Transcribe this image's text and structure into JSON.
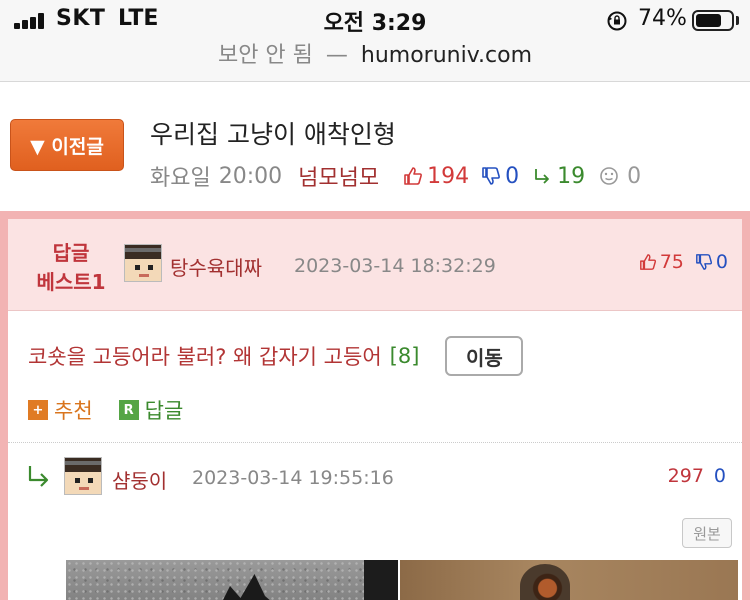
{
  "status_bar": {
    "carrier": "SKT",
    "network": "LTE",
    "time": "오전 3:29",
    "battery_percent": "74%",
    "battery_level": 0.74
  },
  "url_bar": {
    "insecure_label": "보안 안 됨",
    "separator": "—",
    "domain": "humoruniv.com"
  },
  "post": {
    "prev_button_label": "▼ 이전글",
    "title": "우리집 고냥이 애착인형",
    "day": "화요일",
    "time": "20:00",
    "author": "넘모넘모",
    "upvotes": "194",
    "downvotes": "0",
    "replies": "19",
    "views": "0"
  },
  "best_comment": {
    "badge_line1": "답글",
    "badge_line2": "베스트1",
    "author": "탕수육대짜",
    "date": "2023-03-14 18:32:29",
    "upvotes": "75",
    "downvotes": "0",
    "text": "코숏을 고등어라 불러? 왜 갑자기 고등어",
    "reply_count": "[8]",
    "move_button": "이동",
    "recommend_label": "추천",
    "recommend_icon": "+",
    "reply_label": "답글",
    "reply_icon": "R"
  },
  "reply": {
    "author": "샴둥이",
    "date": "2023-03-14 19:55:16",
    "upvotes": "297",
    "downvotes": "0",
    "original_button": "원본"
  },
  "colors": {
    "prev_button": "#e8692a",
    "best_border": "#f2b3b3",
    "best_bg": "#fbe3e3",
    "author_red": "#a23030",
    "up_red": "#d23a3a",
    "down_blue": "#2450c0",
    "reply_green": "#3b8a2e"
  }
}
